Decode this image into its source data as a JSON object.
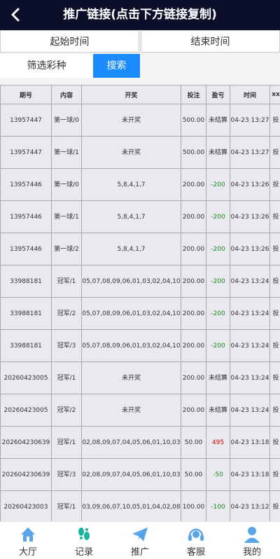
{
  "header": {
    "title": "推广链接(点击下方链接复制)",
    "back_icon": "chevron-left-icon"
  },
  "filters": {
    "start_time": "起始时间",
    "end_time": "结束时间",
    "lottery_filter": "筛选彩种",
    "search_button": "搜索"
  },
  "table": {
    "columns": [
      "期号",
      "内容",
      "开奖",
      "投注",
      "盈亏",
      "时间",
      "xx"
    ],
    "rows": [
      {
        "issue": "13957447",
        "content": "第一球/0",
        "result": "未开奖",
        "bet": "500.00",
        "profit": "未结算",
        "profit_type": "none",
        "time": "04-23 13:27",
        "action": "投"
      },
      {
        "issue": "13957447",
        "content": "第一球/1",
        "result": "未开奖",
        "bet": "500.00",
        "profit": "未结算",
        "profit_type": "none",
        "time": "04-23 13:27",
        "action": "投"
      },
      {
        "issue": "13957446",
        "content": "第一球/0",
        "result": "5,8,4,1,7",
        "bet": "200.00",
        "profit": "-200",
        "profit_type": "neg",
        "time": "04-23 13:26",
        "action": "投"
      },
      {
        "issue": "13957446",
        "content": "第一球/1",
        "result": "5,8,4,1,7",
        "bet": "200.00",
        "profit": "-200",
        "profit_type": "neg",
        "time": "04-23 13:26",
        "action": "投"
      },
      {
        "issue": "13957446",
        "content": "第一球/2",
        "result": "5,8,4,1,7",
        "bet": "200.00",
        "profit": "-200",
        "profit_type": "neg",
        "time": "04-23 13:26",
        "action": "投"
      },
      {
        "issue": "33988181",
        "content": "冠军/1",
        "result": "05,07,08,09,06,01,03,02,04,10",
        "bet": "200.00",
        "profit": "-200",
        "profit_type": "neg",
        "time": "04-23 13:24",
        "action": "投"
      },
      {
        "issue": "33988181",
        "content": "冠军/2",
        "result": "05,07,08,09,06,01,03,02,04,10",
        "bet": "200.00",
        "profit": "-200",
        "profit_type": "neg",
        "time": "04-23 13:24",
        "action": "投"
      },
      {
        "issue": "33988181",
        "content": "冠军/3",
        "result": "05,07,08,09,06,01,03,02,04,10",
        "bet": "200.00",
        "profit": "-200",
        "profit_type": "neg",
        "time": "04-23 13:24",
        "action": "投"
      },
      {
        "issue": "20260423005",
        "content": "冠军/1",
        "result": "未开奖",
        "bet": "200.00",
        "profit": "未结算",
        "profit_type": "none",
        "time": "04-23 13:24",
        "action": "投"
      },
      {
        "issue": "20260423005",
        "content": "冠军/2",
        "result": "未开奖",
        "bet": "200.00",
        "profit": "未结算",
        "profit_type": "none",
        "time": "04-23 13:24",
        "action": "投"
      },
      {
        "issue": "202604230639",
        "content": "冠军/1",
        "result": "02,08,09,07,04,05,06,01,10,03",
        "bet": "50.00",
        "profit": "495",
        "profit_type": "pos",
        "time": "04-23 13:18",
        "action": "投"
      },
      {
        "issue": "202604230639",
        "content": "冠军/3",
        "result": "02,08,09,07,04,05,06,01,10,03",
        "bet": "50.00",
        "profit": "-50",
        "profit_type": "neg",
        "time": "04-23 13:18",
        "action": "投"
      },
      {
        "issue": "20260423003",
        "content": "冠军/1",
        "result": "03,09,06,07,10,05,01,04,02,08",
        "bet": "100.00",
        "profit": "-100",
        "profit_type": "neg",
        "time": "04-23 13:12",
        "action": "投"
      }
    ]
  },
  "bottom_nav": [
    {
      "label": "大厅",
      "icon": "house-icon",
      "color": "#5aa6e8"
    },
    {
      "label": "记录",
      "icon": "footprints-icon",
      "color": "#1bb3a0"
    },
    {
      "label": "推广",
      "icon": "paper-plane-icon",
      "color": "#5aa6e8"
    },
    {
      "label": "客服",
      "icon": "headset-icon",
      "color": "#5aa6e8"
    },
    {
      "label": "我的",
      "icon": "user-icon",
      "color": "#5aa6e8"
    }
  ]
}
